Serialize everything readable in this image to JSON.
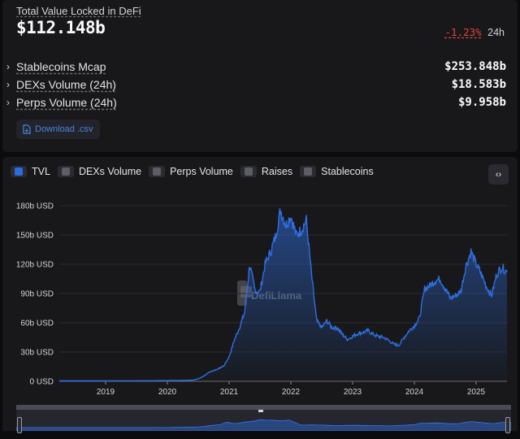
{
  "summary": {
    "tvl_label": "Total Value Locked in DeFi",
    "tvl_value": "$112.148b",
    "tvl_change": "-1.23%",
    "tvl_period": "24h",
    "stats": [
      {
        "label": "Stablecoins Mcap",
        "value": "$253.848b"
      },
      {
        "label": "DEXs Volume (24h)",
        "value": "$18.583b"
      },
      {
        "label": "Perps Volume (24h)",
        "value": "$9.958b"
      }
    ],
    "download_label": "Download .csv"
  },
  "toggles": [
    {
      "label": "TVL",
      "active": true
    },
    {
      "label": "DEXs Volume",
      "active": false
    },
    {
      "label": "Perps Volume",
      "active": false
    },
    {
      "label": "Raises",
      "active": false
    },
    {
      "label": "Stablecoins",
      "active": false
    }
  ],
  "watermark": "DefiLlama",
  "colors": {
    "accent": "#2d6ce0",
    "line": "#2f6fe0",
    "negative": "#e0443b"
  },
  "icons": {
    "expand": "chevron-right-icon",
    "download": "file-download-icon",
    "embed": "code-brackets-icon"
  },
  "chart_data": {
    "type": "area",
    "ylim": [
      0,
      180
    ],
    "y_ticks": [
      "0 USD",
      "30b USD",
      "60b USD",
      "90b USD",
      "120b USD",
      "150b USD",
      "180b USD"
    ],
    "y_tick_values": [
      0,
      30,
      60,
      90,
      120,
      150,
      180
    ],
    "x_ticks": [
      "2019",
      "2020",
      "2021",
      "2022",
      "2023",
      "2024",
      "2025"
    ],
    "x_range": [
      "2018-04",
      "2025-07"
    ],
    "series": [
      {
        "values": [
          [
            "2018-04",
            0.4
          ],
          [
            "2018-10",
            0.4
          ],
          [
            "2019-04",
            0.5
          ],
          [
            "2019-10",
            0.6
          ],
          [
            "2020-01",
            0.7
          ],
          [
            "2020-04",
            0.8
          ],
          [
            "2020-06",
            1.2
          ],
          [
            "2020-07",
            2.5
          ],
          [
            "2020-08",
            5
          ],
          [
            "2020-09",
            9
          ],
          [
            "2020-10",
            11
          ],
          [
            "2020-11",
            13
          ],
          [
            "2020-12",
            16
          ],
          [
            "2021-01",
            25
          ],
          [
            "2021-02",
            42
          ],
          [
            "2021-03",
            55
          ],
          [
            "2021-04",
            70
          ],
          [
            "2021-05",
            120
          ],
          [
            "2021-06",
            93
          ],
          [
            "2021-07",
            92
          ],
          [
            "2021-08",
            120
          ],
          [
            "2021-09",
            132
          ],
          [
            "2021-10",
            148
          ],
          [
            "2021-11",
            176
          ],
          [
            "2021-12",
            160
          ],
          [
            "2022-01",
            170
          ],
          [
            "2022-02",
            150
          ],
          [
            "2022-03",
            155
          ],
          [
            "2022-04",
            165
          ],
          [
            "2022-05",
            110
          ],
          [
            "2022-06",
            62
          ],
          [
            "2022-07",
            55
          ],
          [
            "2022-08",
            62
          ],
          [
            "2022-09",
            55
          ],
          [
            "2022-10",
            55
          ],
          [
            "2022-11",
            48
          ],
          [
            "2022-12",
            43
          ],
          [
            "2023-01",
            46
          ],
          [
            "2023-02",
            49
          ],
          [
            "2023-03",
            50
          ],
          [
            "2023-04",
            52
          ],
          [
            "2023-05",
            48
          ],
          [
            "2023-06",
            46
          ],
          [
            "2023-07",
            45
          ],
          [
            "2023-08",
            42
          ],
          [
            "2023-09",
            38
          ],
          [
            "2023-10",
            37
          ],
          [
            "2023-11",
            45
          ],
          [
            "2023-12",
            52
          ],
          [
            "2024-01",
            57
          ],
          [
            "2024-02",
            65
          ],
          [
            "2024-03",
            95
          ],
          [
            "2024-04",
            98
          ],
          [
            "2024-05",
            103
          ],
          [
            "2024-06",
            105
          ],
          [
            "2024-07",
            95
          ],
          [
            "2024-08",
            85
          ],
          [
            "2024-09",
            88
          ],
          [
            "2024-10",
            92
          ],
          [
            "2024-11",
            118
          ],
          [
            "2024-12",
            133
          ],
          [
            "2025-01",
            120
          ],
          [
            "2025-02",
            110
          ],
          [
            "2025-03",
            97
          ],
          [
            "2025-04",
            88
          ],
          [
            "2025-05",
            110
          ],
          [
            "2025-06",
            117
          ],
          [
            "2025-07",
            112
          ]
        ]
      }
    ]
  }
}
